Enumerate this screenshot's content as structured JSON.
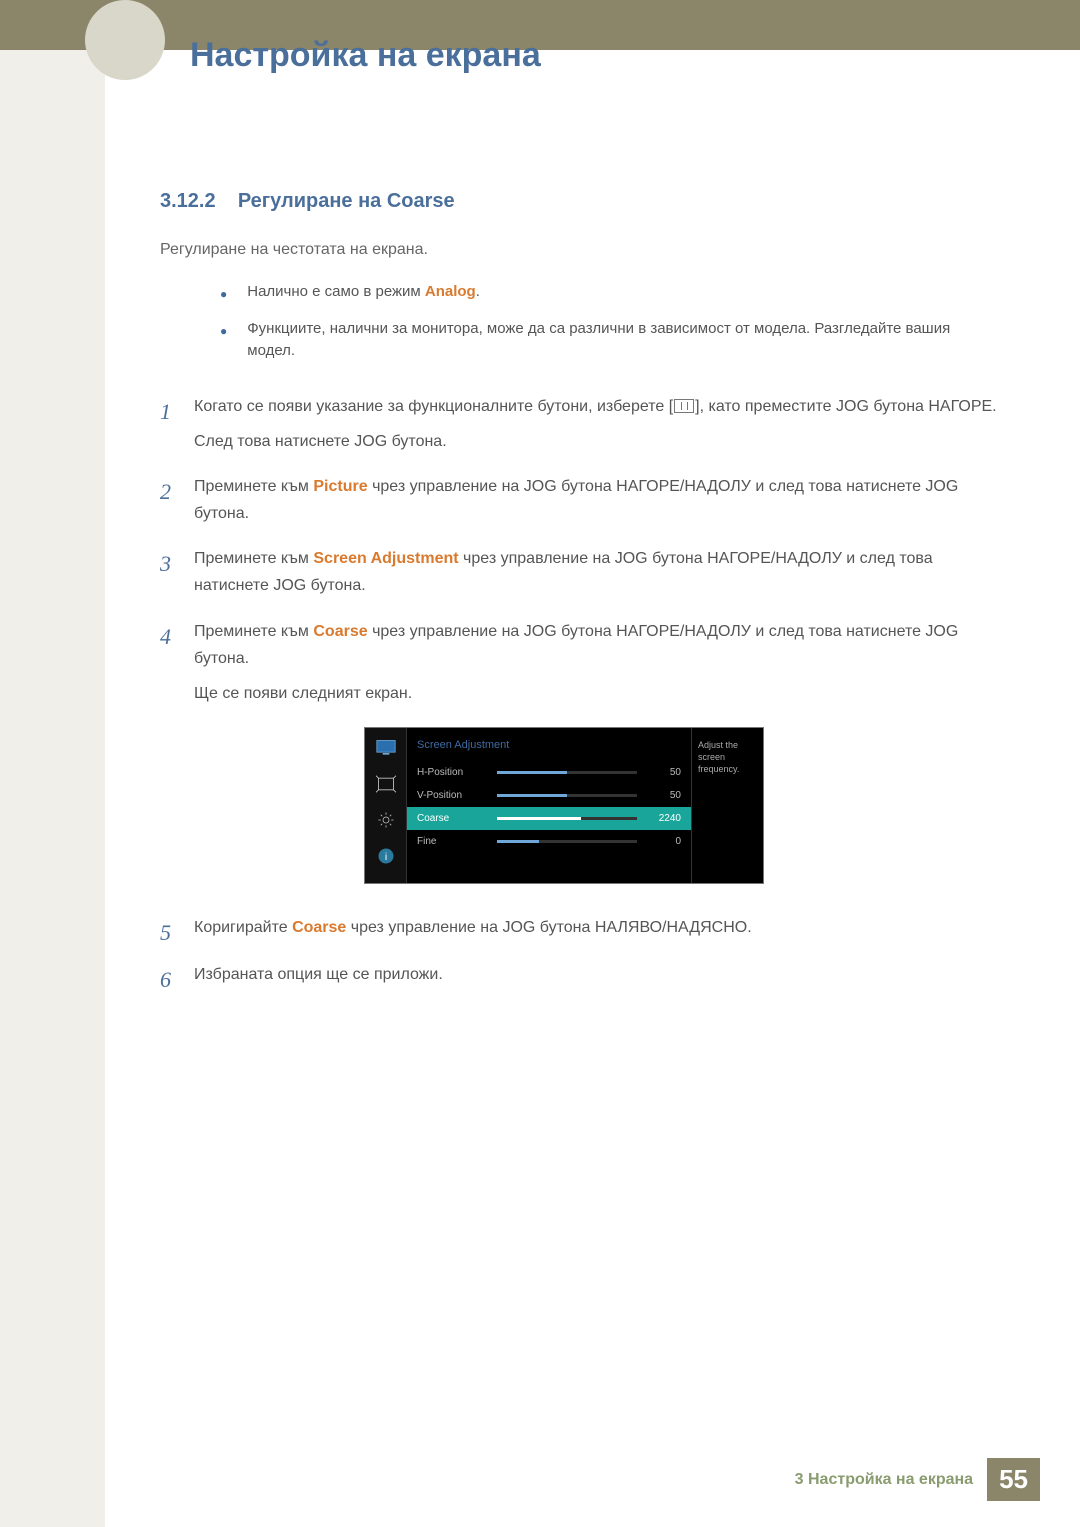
{
  "header": {
    "title": "Настройка на екрана"
  },
  "section": {
    "number": "3.12.2",
    "title": "Регулиране на Coarse",
    "intro": "Регулиране на честотата на екрана."
  },
  "notes": {
    "n1_a": "Налично е само в режим ",
    "n1_b": "Analog",
    "n1_c": ".",
    "n2": "Функциите, налични за монитора, може да са различни в зависимост от модела. Разгледайте вашия модел."
  },
  "steps": {
    "s1": {
      "num": "1",
      "a": "Когато се появи указание за функционалните бутони, изберете [",
      "b": "], като преместите JOG бутона НАГОРЕ.",
      "c": "След това натиснете JOG бутона."
    },
    "s2": {
      "num": "2",
      "a": "Преминете към ",
      "kw": "Picture",
      "b": " чрез управление на JOG бутона НАГОРЕ/НАДОЛУ и след това натиснете JOG бутона."
    },
    "s3": {
      "num": "3",
      "a": "Преминете към ",
      "kw": "Screen Adjustment",
      "b": " чрез управление на JOG бутона НАГОРЕ/НАДОЛУ и след това натиснете JOG бутона."
    },
    "s4": {
      "num": "4",
      "a": "Преминете към ",
      "kw": "Coarse",
      "b": " чрез управление на JOG бутона НАГОРЕ/НАДОЛУ и след това натиснете JOG бутона.",
      "c": "Ще се появи следният екран."
    },
    "s5": {
      "num": "5",
      "a": "Коригирайте ",
      "kw": "Coarse",
      "b": " чрез управление на JOG бутона НАЛЯВО/НАДЯСНО."
    },
    "s6": {
      "num": "6",
      "a": "Избраната опция ще се приложи."
    }
  },
  "osd": {
    "title": "Screen Adjustment",
    "rows": [
      {
        "label": "H-Position",
        "value": "50",
        "fill": "50%",
        "sel": false
      },
      {
        "label": "V-Position",
        "value": "50",
        "fill": "50%",
        "sel": false
      },
      {
        "label": "Coarse",
        "value": "2240",
        "fill": "60%",
        "sel": true
      },
      {
        "label": "Fine",
        "value": "0",
        "fill": "30%",
        "sel": false
      }
    ],
    "help": "Adjust the screen frequency."
  },
  "footer": {
    "text": "3 Настройка на екрана",
    "page": "55"
  }
}
